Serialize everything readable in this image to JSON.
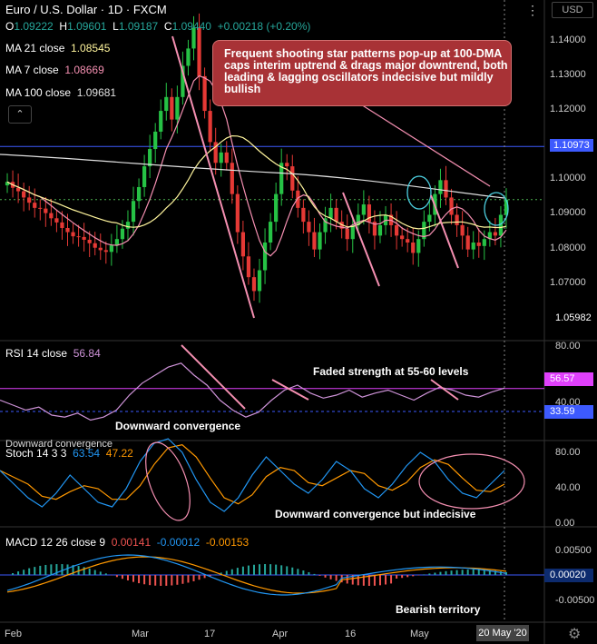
{
  "header": {
    "title": "Euro / U.S. Dollar · 1D · FXCM",
    "ohlc": {
      "o_label": "O",
      "o": "1.09222",
      "h_label": "H",
      "h": "1.09601",
      "l_label": "L",
      "l": "1.09187",
      "c_label": "C",
      "c": "1.09440",
      "change": "+0.00218 (+0.20%)"
    },
    "more_icon": "three-dots-icon",
    "currency": "USD"
  },
  "legend": {
    "ma21_label": "MA 21 close",
    "ma21_value": "1.08545",
    "ma21_color": "#fff59d",
    "ma7_label": "MA 7 close",
    "ma7_value": "1.08669",
    "ma7_color": "#f48fb1",
    "ma100_label": "MA 100 close",
    "ma100_value": "1.09681",
    "ma100_color": "#e0e0e0",
    "collapse_icon": "chevron-up-icon"
  },
  "annotation_box": "Frequent shooting star patterns pop-up at 100-DMA caps interim uptrend & drags major downtrend, both leading & lagging oscillators indecisive but mildly bullish",
  "price_axis": {
    "ticks": [
      "1.14000",
      "1.13000",
      "1.12000",
      "1.10973",
      "1.10000",
      "1.09000",
      "1.08000",
      "1.07000",
      "1.05982"
    ],
    "tick_values": [
      1.14,
      1.13,
      1.12,
      1.10973,
      1.1,
      1.09,
      1.08,
      1.07,
      1.05982
    ],
    "highlight_level": "1.10973",
    "bottom_level": "1.05982",
    "colors": {
      "up": "#26c245",
      "down": "#e53935",
      "level_line": "#3d5afe",
      "current_line": "#4caf50"
    }
  },
  "rsi": {
    "label": "RSI 14 close",
    "value": "56.84",
    "ticks": [
      "80.00",
      "40.00"
    ],
    "levels": {
      "upper": "56.57",
      "lower": "33.59"
    },
    "annotation_top": "Faded strength at 55-60 levels",
    "annotation_bottom": "Downward convergence",
    "line_color": "#ce93d8"
  },
  "stoch": {
    "label": "Stoch 14 3 3",
    "k": "63.54",
    "d": "47.22",
    "overlay_text": "Downward convergence",
    "ticks": [
      "80.00",
      "40.00",
      "0.00"
    ],
    "annotation": "Downward convergence but indecisive",
    "k_color": "#2196f3",
    "d_color": "#ff9800"
  },
  "macd": {
    "label": "MACD 12 26 close 9",
    "hist": "0.00141",
    "macd": "-0.00012",
    "signal": "-0.00153",
    "ticks": [
      "0.00500",
      "0.00020",
      "-0.00500"
    ],
    "annotation": "Bearish territory",
    "macd_color": "#2196f3",
    "signal_color": "#ff9800"
  },
  "x_axis": {
    "labels": [
      "Feb",
      "Mar",
      "17",
      "Apr",
      "16",
      "May",
      "Ma"
    ],
    "current_date": "20 May '20",
    "settings_icon": "gear-icon"
  },
  "chart_data": {
    "type": "candlestick",
    "title": "Euro / U.S. Dollar · 1D · FXCM",
    "ylim": [
      1.055,
      1.152
    ],
    "closes": [
      1.0995,
      1.0978,
      1.0968,
      1.095,
      1.0935,
      1.092,
      1.0918,
      1.0905,
      1.089,
      1.0878,
      1.0862,
      1.085,
      1.0838,
      1.0836,
      1.0828,
      1.0818,
      1.0805,
      1.0798,
      1.0793,
      1.0812,
      1.083,
      1.086,
      1.088,
      1.094,
      1.098,
      1.104,
      1.109,
      1.114,
      1.12,
      1.124,
      1.1175,
      1.124,
      1.133,
      1.138,
      1.144,
      1.13,
      1.12,
      1.111,
      1.105,
      1.108,
      1.105,
      1.096,
      1.085,
      1.078,
      1.072,
      1.068,
      1.074,
      1.082,
      1.088,
      1.096,
      1.105,
      1.104,
      1.097,
      1.092,
      1.088,
      1.085,
      1.08,
      1.085,
      1.089,
      1.092,
      1.088,
      1.086,
      1.083,
      1.087,
      1.09,
      1.093,
      1.088,
      1.084,
      1.087,
      1.09,
      1.087,
      1.084,
      1.083,
      1.082,
      1.079,
      1.083,
      1.088,
      1.09,
      1.096,
      1.1,
      1.095,
      1.09,
      1.087,
      1.084,
      1.08,
      1.082,
      1.081,
      1.083,
      1.085,
      1.084,
      1.09,
      1.0944
    ]
  }
}
